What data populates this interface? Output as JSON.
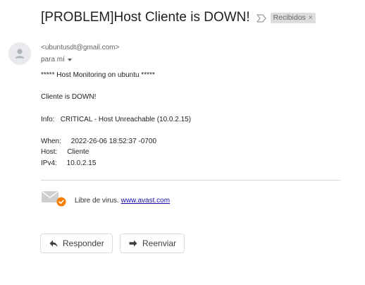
{
  "email": {
    "subject": "[PROBLEM]Host Cliente is DOWN!",
    "label": "Recibidos",
    "label_remove": "×",
    "sender": "<ubuntusdt@gmail.com>",
    "recipient": "para mí",
    "body": {
      "line1": "***** Host Monitoring on ubuntu *****",
      "line2": "Cliente is DOWN!",
      "info": "Info:   CRITICAL - Host Unreachable (10.0.2.15)",
      "when": "When:     2022-26-06 18:52:37 -0700",
      "host": "Host:     Cliente",
      "ipv4": "IPv4:     10.0.2.15"
    },
    "antivirus": {
      "text": "Libre de virus. ",
      "link": "www.avast.com"
    }
  },
  "actions": {
    "reply_label": "Responder",
    "forward_label": "Reenviar"
  },
  "colors": {
    "avatar_bg": "#e8eaed",
    "avast_orange": "#f57c00",
    "link": "#1a0dab"
  },
  "icons": {
    "important": "important-marker-icon",
    "avatar": "person-icon",
    "avast": "avast-mail-icon",
    "reply": "reply-arrow-icon",
    "forward": "forward-arrow-icon"
  }
}
